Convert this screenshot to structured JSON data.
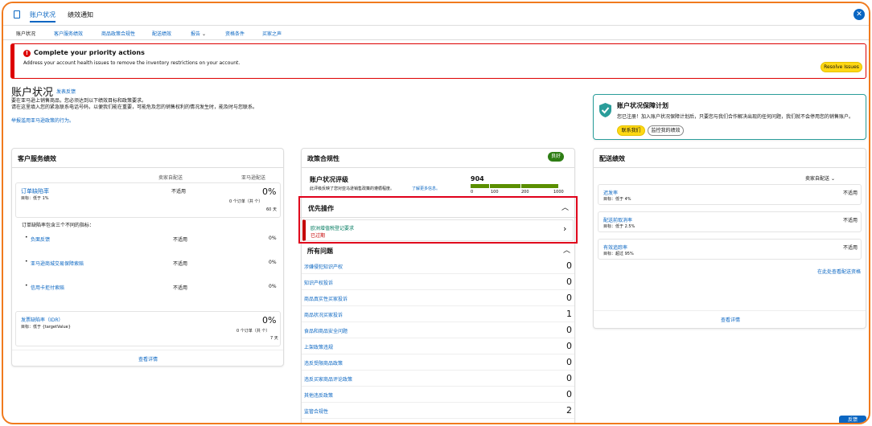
{
  "tabs": {
    "t1": "账户状况",
    "t2": "绩效通知"
  },
  "subnav": [
    "账户状况",
    "客户服务绩效",
    "商品政策合规性",
    "配送绩效",
    "报告",
    "资格条件",
    "买家之声"
  ],
  "alert": {
    "title": "Complete your priority actions",
    "desc": "Address your account health issues to remove the inventory restrictions on your account.",
    "button": "Resolve Issues"
  },
  "page": {
    "title": "账户状况",
    "feedback_link": "发表反馈",
    "desc1": "要在亚马逊上销售商品，您必须达到以下绩效目标和政策要求。",
    "desc2": "请在这里填入您的紧急联系电话号码，以便我们能在重要，可能危及您的销售权利的情况发生时，能及时与您联系。",
    "report_link": "举报滥用亚马逊政策的行为。"
  },
  "ahp": {
    "title": "账户状况保障计划",
    "desc": "您已注册！加入账户状况保障计划后，只要您与我们合作解决出现的任何问题，我们就不会停用您的销售账户。",
    "btn_contact": "联系我们",
    "btn_monitor": "监控我的绩效"
  },
  "cs": {
    "title": "客户服务绩效",
    "col1": "卖家自配送",
    "col2": "亚马逊配送",
    "odr_link": "订单缺陷率",
    "odr_target": "目标：低于 1%",
    "odr_status": "不适用",
    "odr_pct": "0%",
    "odr_orders": "0 个订单（共  个）",
    "odr_days": "60 天",
    "note": "订单缺陷率包含三个不同的指标：",
    "metrics": [
      {
        "name": "负面反馈",
        "status": "不适用",
        "pct": "0%"
      },
      {
        "name": "亚马逊商城交易保障索赔",
        "status": "不适用",
        "pct": "0%"
      },
      {
        "name": "信用卡拒付索赔",
        "status": "不适用",
        "pct": "0%"
      }
    ],
    "idr_link": "发票缺陷率（IDR）",
    "idr_target": "目标：低于 {targetValue}",
    "idr_pct": "0%",
    "idr_orders": "0 个订单（共  个）",
    "idr_days": "7 天",
    "details": "查看详情"
  },
  "pc": {
    "title": "政策合规性",
    "badge": "良好",
    "rating_title": "账户状况评级",
    "rating_desc": "此评级反映了您对亚马逊销售政策的遵循程度。",
    "rating_more": "了解更多信息。",
    "score": "904",
    "ticks": [
      "0",
      "100",
      "200",
      "1000"
    ],
    "priority_title": "优先操作",
    "priority_item": "欧洲增值税登记要求",
    "priority_status": "已过期",
    "all_title": "所有问题",
    "issues": [
      {
        "name": "涉嫌侵犯知识产权",
        "count": "0"
      },
      {
        "name": "知识产权投诉",
        "count": "0"
      },
      {
        "name": "商品真实性买家投诉",
        "count": "0"
      },
      {
        "name": "商品状况买家投诉",
        "count": "1"
      },
      {
        "name": "食品和商品安全问题",
        "count": "0"
      },
      {
        "name": "上架政策违规",
        "count": "0"
      },
      {
        "name": "违反受限商品政策",
        "count": "0"
      },
      {
        "name": "违反买家商品评论政策",
        "count": "0"
      },
      {
        "name": "其他违反政策",
        "count": "0"
      },
      {
        "name": "监管合规性",
        "count": "2"
      }
    ]
  },
  "sp": {
    "title": "配送绩效",
    "filter": "卖家自配送",
    "metrics": [
      {
        "name": "迟发率",
        "target": "目标：低于 4%",
        "status": "不适用"
      },
      {
        "name": "配送前取消率",
        "target": "目标：低于 2.5%",
        "status": "不适用"
      },
      {
        "name": "有效追踪率",
        "target": "目标：超过 95%",
        "status": "不适用"
      }
    ],
    "view_link": "在此处查看配送资格",
    "details": "查看详情"
  },
  "feedback": "反馈"
}
